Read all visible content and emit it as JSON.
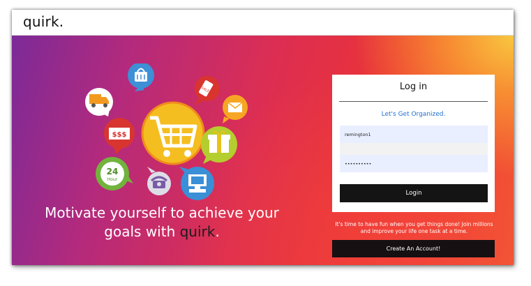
{
  "app": {
    "brand": "quirk."
  },
  "hero": {
    "tagline_prefix": "Motivate yourself to achieve your goals with ",
    "tagline_brand": "quirk",
    "tagline_suffix": ".",
    "illustration": {
      "icons": [
        "shopping-bag-icon",
        "delivery-truck-icon",
        "sale-tag-icon",
        "envelope-icon",
        "shopping-cart-icon",
        "money-icon",
        "gift-box-icon",
        "24-hour-icon",
        "telephone-icon",
        "computer-icon"
      ],
      "money_text": "$$$",
      "sale_text": "SALE",
      "hour_number": "24",
      "hour_word": "Hour"
    }
  },
  "login": {
    "title": "Log in",
    "subtitle": "Let's Get Organized.",
    "username_value": "remington1",
    "password_value": "••••••••••",
    "login_label": "Login"
  },
  "promo": {
    "line1": "It's time to have fun when you get things done! Join millions",
    "line2": "and improve your life one task at a time."
  },
  "create_account": {
    "label": "Create An Account!"
  },
  "colors": {
    "accent_link": "#1f6fd1",
    "button_dark": "#141414",
    "gradient_purple": "#7c2a98",
    "gradient_red": "#ec3332",
    "gradient_orange": "#f8c73f"
  }
}
